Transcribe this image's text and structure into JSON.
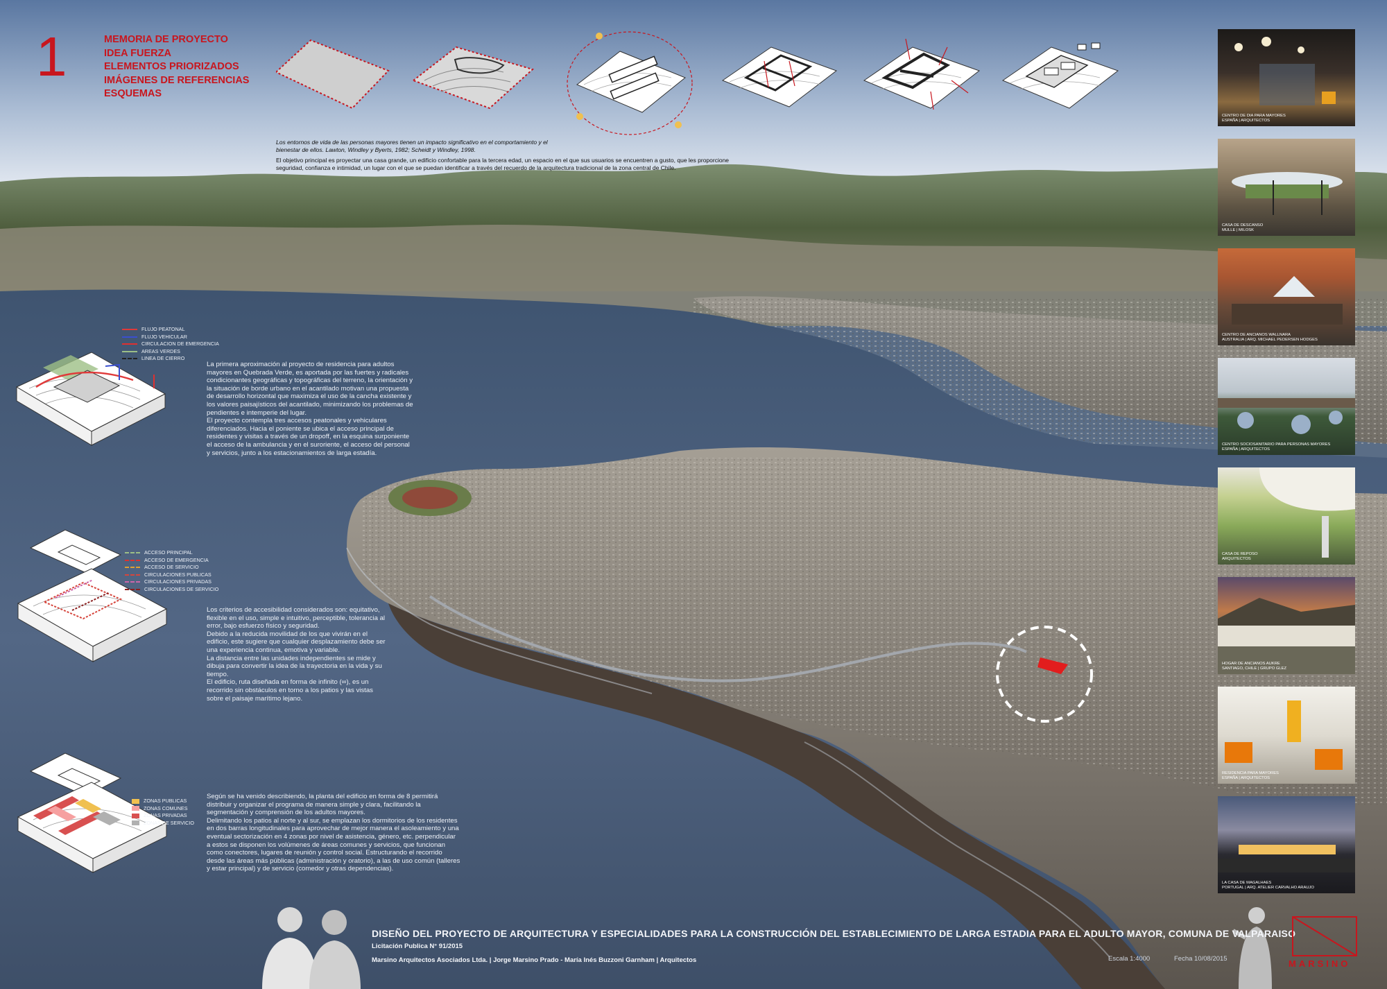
{
  "sheet": {
    "number": "1",
    "headings": [
      "MEMORIA DE PROYECTO",
      "IDEA FUERZA",
      "ELEMENTOS PRIORIZADOS",
      "IMÁGENES DE REFERENCIAS",
      "ESQUEMAS"
    ],
    "quote": "Los entornos de vida de las personas mayores tienen un impacto significativo en el comportamiento y el bienestar de ellos. Lawton, Windley y Byerts, 1982; Scheidt y Windley, 1998.",
    "objective": "El objetivo principal es proyectar una casa grande, un edificio confortable para la tercera edad, un espacio en el que sus usuarios se encuentren a gusto, que les proporcione seguridad, confianza e intimidad, un lugar con el que se puedan identificar a través del recuerdo de la arquitectura tradicional de la zona central de Chile."
  },
  "legend1": [
    {
      "label": "FLUJO PEATONAL",
      "color": "#e03a3a"
    },
    {
      "label": "FLUJO VEHICULAR",
      "color": "#3a4fd0"
    },
    {
      "label": "CIRCULACION DE EMERGENCIA",
      "color": "#e0302f"
    },
    {
      "label": "AREAS VERDES",
      "color": "#9dbf86"
    },
    {
      "label": "LINEA DE CIERRO",
      "color": "#222222"
    }
  ],
  "legend2": [
    {
      "label": "ACCESO PRINCIPAL",
      "color": "#9dbf86"
    },
    {
      "label": "ACCESO DE EMERGENCIA",
      "color": "#e0302f"
    },
    {
      "label": "ACCESO DE SERVICIO",
      "color": "#e0a030"
    },
    {
      "label": "CIRCULACIONES PUBLICAS",
      "color": "#d6453c"
    },
    {
      "label": "CIRCULACIONES PRIVADAS",
      "color": "#cc66aa"
    },
    {
      "label": "CIRCULACIONES DE SERVICIO",
      "color": "#8a1f1f"
    }
  ],
  "legend3": [
    {
      "label": "ZONAS PUBLICAS",
      "color": "#f0c050"
    },
    {
      "label": "ZONAS COMUNES",
      "color": "#f6a0a0"
    },
    {
      "label": "ZONAS PRIVADAS",
      "color": "#d85050"
    },
    {
      "label": "ZONAS DE SERVICIO",
      "color": "#b0b0b0"
    }
  ],
  "text1": "La primera aproximación al proyecto de residencia para adultos mayores en Quebrada Verde, es aportada por las fuertes y radicales condicionantes geográficas y topográficas del terreno, la orientación y la situación de borde urbano en el acantilado motivan una propuesta de desarrollo horizontal que maximiza el uso de la cancha existente y los valores paisajísticos del acantilado, minimizando los problemas de pendientes e intemperie del lugar.\nEl proyecto contempla tres accesos peatonales y vehiculares diferenciados. Hacia el poniente se ubica el acceso principal de residentes y visitas a través de un dropoff, en la esquina surponiente el acceso de la ambulancia y en el suroriente, el acceso del personal y servicios, junto a los estacionamientos de larga estadía.",
  "text2": "Los criterios de accesibilidad considerados son: equitativo, flexible en el uso, simple e intuitivo, perceptible, tolerancia al error, bajo esfuerzo físico y seguridad.\nDebido a la reducida movilidad de los que vivirán en el edificio, este sugiere que cualquier desplazamiento debe ser una experiencia continua, emotiva y variable.\nLa distancia entre las unidades independientes se mide y dibuja para convertir la idea de la trayectoria en la vida y su tiempo.\nEl edificio, ruta diseñada en forma de infinito (∞), es un recorrido sin obstáculos en torno a los patios y las vistas sobre el paisaje marítimo lejano.",
  "text3": "Según se ha venido describiendo, la planta del edificio en forma de 8 permitirá distribuir y organizar el programa de manera simple y clara, facilitando la segmentación y comprensión de los adultos mayores.\nDelimitando los patios al norte y al sur, se emplazan los dormitorios de los residentes en dos barras longitudinales para aprovechar de mejor manera el asoleamiento y una eventual sectorización en 4 zonas por nivel de asistencia, género, etc. perpendicular a estos se disponen los volúmenes de áreas comunes y servicios, que funcionan como conectores, lugares de reunión y control social. Estructurando el recorrido desde las áreas más públicas (administración y oratorio), a las de uso común (talleres y estar principal) y de servicio (comedor y otras dependencias).",
  "references": [
    {
      "caption": "CENTRO DE DIA PARA MAYORES\nESPAÑA | ARQUITECTOS"
    },
    {
      "caption": "CASA DE DESCANSO\nMULLE | MILOSK"
    },
    {
      "caption": "CENTRO DE ANCIANOS WALLNARA\nAUSTRALIA | ARQ. MICHAEL PEDERSEN HODGES"
    },
    {
      "caption": "CENTRO SOCIOSANITARIO PARA PERSONAS MAYORES\nESPAÑA | ARQUITECTOS"
    },
    {
      "caption": "CASA DE REPOSO\nARQUITECTOS"
    },
    {
      "caption": "HOGAR DE ANCIANOS AUKRE\nSANTIAGO, CHILE | GRUPO GLEZ"
    },
    {
      "caption": "RESIDENCIA PARA MAYORES\nESPAÑA | ARQUITECTOS"
    },
    {
      "caption": "LA CASA DE MAGALHAES\nPORTUGAL | ARQ. ATELIER CARVALHO ARAUJO"
    }
  ],
  "footer": {
    "title": "DISEÑO DEL PROYECTO DE ARQUITECTURA Y ESPECIALIDADES PARA LA CONSTRUCCIÓN DEL ESTABLECIMIENTO DE LARGA ESTADIA PARA EL ADULTO MAYOR, COMUNA DE VALPARAISO",
    "licitacion": "Licitación Publica N° 91/2015",
    "authors": "Marsino Arquitectos Asociados Ltda.  |  Jorge Marsino Prado  -  María Inés Buzzoni Garnham  |  Arquitectos",
    "scale": "Escala 1:4000",
    "date": "Fecha 10/08/2015",
    "logo": "MARSINO"
  },
  "colors": {
    "accent": "#c8161e",
    "sea": "#4d607c",
    "sky_top": "#5f7aa2",
    "sky_bottom": "#dde4ee"
  }
}
